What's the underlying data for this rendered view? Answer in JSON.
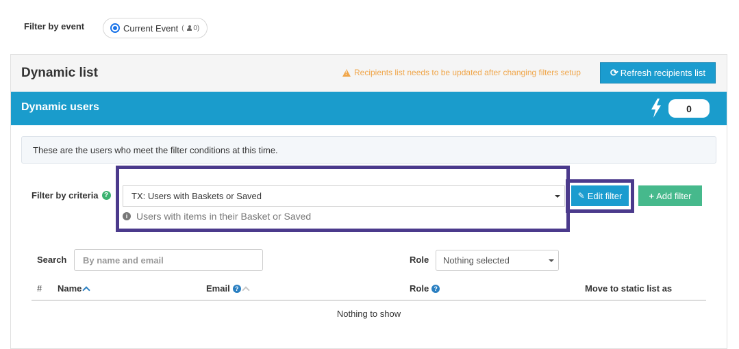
{
  "filter_event": {
    "label": "Filter by event",
    "option_label": "Current Event",
    "option_count_open": "(",
    "option_count": "0",
    "option_count_close": ")",
    "option_icon": "user-icon"
  },
  "panel": {
    "title": "Dynamic list",
    "warning_text": "Recipients list needs to be updated after changing filters setup",
    "warning_icon": "warning-icon",
    "refresh_label": "Refresh recipients list",
    "refresh_icon": "refresh-icon"
  },
  "dynamic_users": {
    "title": "Dynamic users",
    "count": "0",
    "icon": "lightning-bolt-icon",
    "bar_color": "#1a9ccc"
  },
  "info": {
    "text": "These are the users who meet the filter conditions at this time."
  },
  "criteria": {
    "label": "Filter by criteria",
    "selected": "TX: Users with Baskets or Saved",
    "description": "Users with items in their Basket or Saved",
    "edit_label": "Edit filter",
    "add_label": "Add filter",
    "highlight_color": "#4b3a8c"
  },
  "search": {
    "label": "Search",
    "placeholder": "By name and email",
    "value": ""
  },
  "role": {
    "label": "Role",
    "selected": "Nothing selected"
  },
  "table": {
    "columns": {
      "hash": "#",
      "name": "Name",
      "email": "Email",
      "role": "Role",
      "move": "Move to static list as"
    },
    "empty_text": "Nothing to show"
  },
  "colors": {
    "primary": "#1b9ccf",
    "success": "#46b98c",
    "warning": "#f0a64a"
  }
}
